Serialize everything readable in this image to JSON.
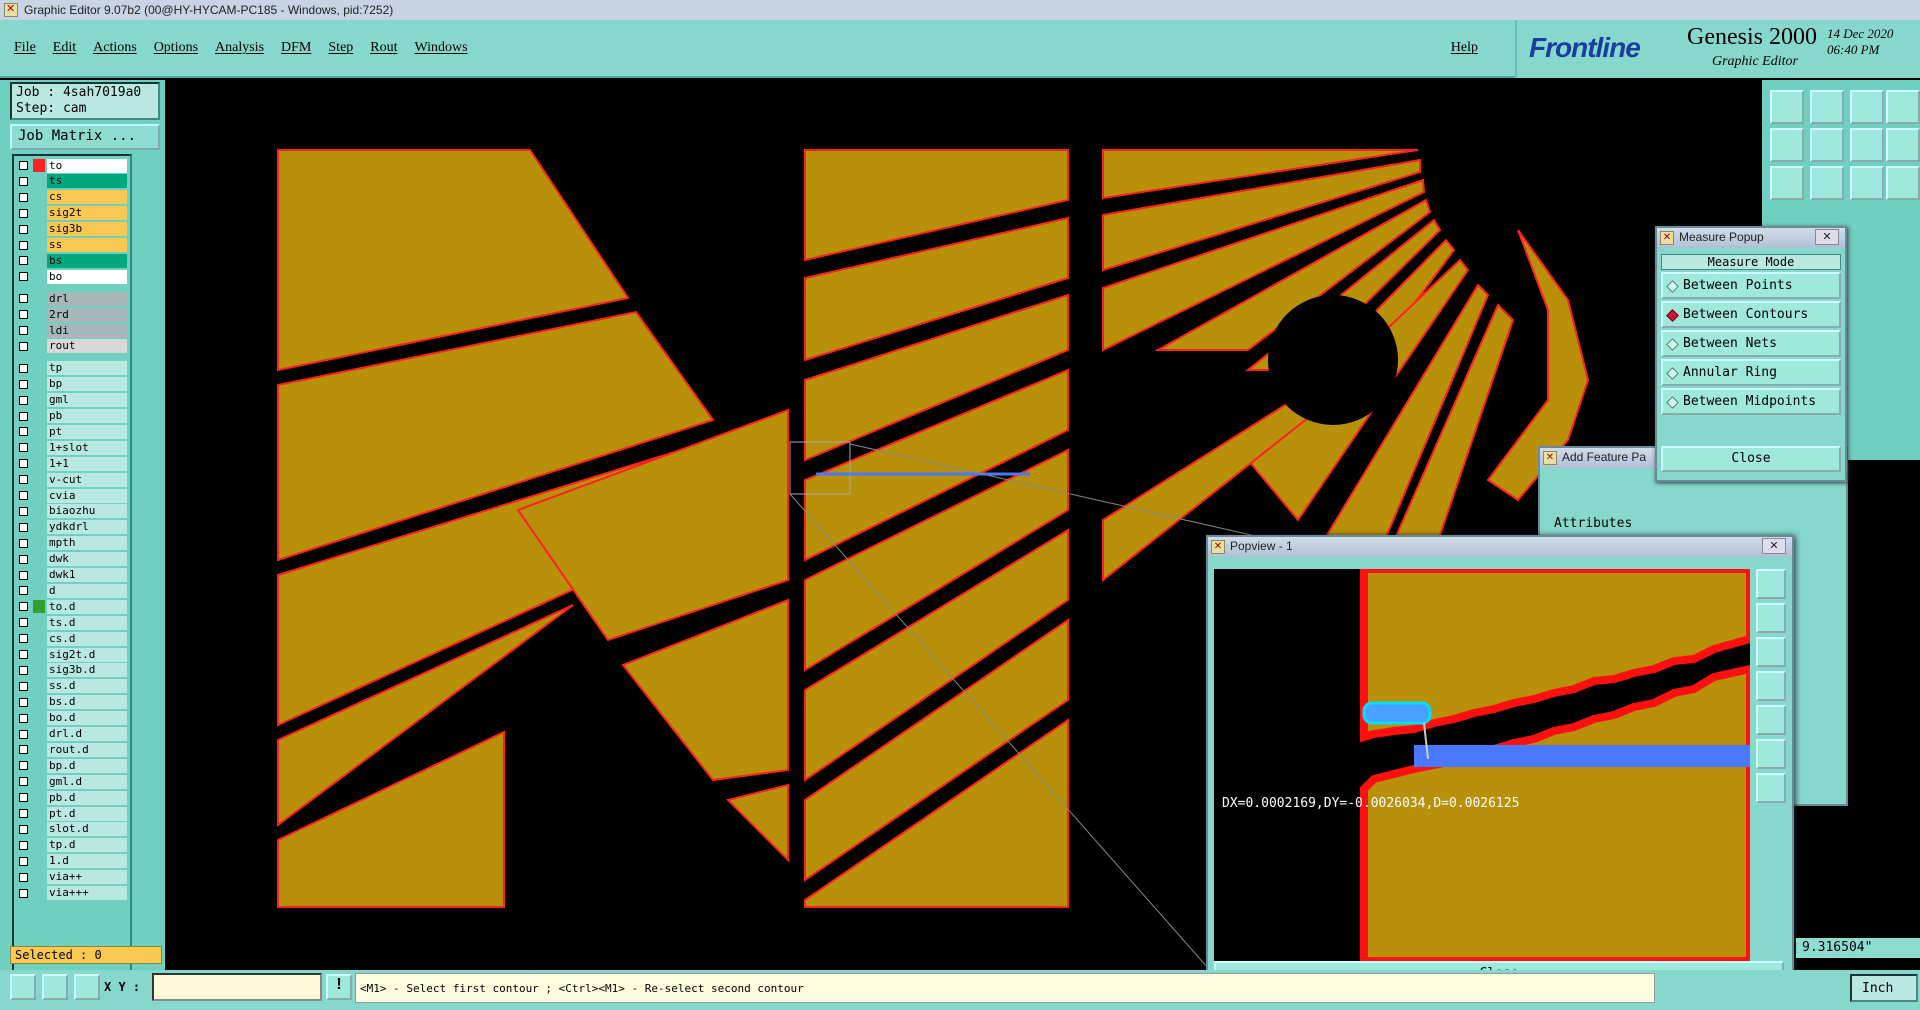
{
  "window": {
    "title": "Graphic Editor 9.07b2 (00@HY-HYCAM-PC185 - Windows, pid:7252)"
  },
  "menu": {
    "items": [
      "File",
      "Edit",
      "Actions",
      "Options",
      "Analysis",
      "DFM",
      "Step",
      "Rout",
      "Windows"
    ],
    "help": "Help"
  },
  "brand": {
    "logo": "Frontline",
    "product": "Genesis 2000",
    "subtitle": "Graphic Editor",
    "date": "14 Dec 2020",
    "time": "06:40 PM"
  },
  "job": {
    "job_line": "Job : 4sah7019a0",
    "step_line": "Step: cam",
    "matrix_button": "Job Matrix ..."
  },
  "layers": [
    {
      "name": "to",
      "color": "#ffffff"
    },
    {
      "name": "ts",
      "color": "#00a880"
    },
    {
      "name": "cs",
      "color": "#f8c850"
    },
    {
      "name": "sig2t",
      "color": "#f8c850"
    },
    {
      "name": "sig3b",
      "color": "#f8c850"
    },
    {
      "name": "ss",
      "color": "#f8c850"
    },
    {
      "name": "bs",
      "color": "#00a880"
    },
    {
      "name": "bo",
      "color": "#ffffff"
    },
    {
      "name": "drl",
      "color": "#a8b8b8"
    },
    {
      "name": "2rd",
      "color": "#a8b8b8"
    },
    {
      "name": "ldi",
      "color": "#a8b8b8"
    },
    {
      "name": "rout",
      "color": "#d8d8d8"
    },
    {
      "name": "tp",
      "color": "#b8e8e0"
    },
    {
      "name": "bp",
      "color": "#b8e8e0"
    },
    {
      "name": "gml",
      "color": "#b8e8e0"
    },
    {
      "name": "pb",
      "color": "#b8e8e0"
    },
    {
      "name": "pt",
      "color": "#b8e8e0"
    },
    {
      "name": "1+slot",
      "color": "#b8e8e0"
    },
    {
      "name": "1+1",
      "color": "#b8e8e0"
    },
    {
      "name": "v-cut",
      "color": "#b8e8e0"
    },
    {
      "name": "cvia",
      "color": "#b8e8e0"
    },
    {
      "name": "biaozhu",
      "color": "#b8e8e0"
    },
    {
      "name": "ydkdrl",
      "color": "#b8e8e0"
    },
    {
      "name": "mpth",
      "color": "#b8e8e0"
    },
    {
      "name": "dwk",
      "color": "#b8e8e0"
    },
    {
      "name": "dwk1",
      "color": "#b8e8e0"
    },
    {
      "name": "d",
      "color": "#b8e8e0"
    },
    {
      "name": "to.d",
      "color": "#b8e8e0"
    },
    {
      "name": "ts.d",
      "color": "#b8e8e0"
    },
    {
      "name": "cs.d",
      "color": "#b8e8e0"
    },
    {
      "name": "sig2t.d",
      "color": "#b8e8e0"
    },
    {
      "name": "sig3b.d",
      "color": "#b8e8e0"
    },
    {
      "name": "ss.d",
      "color": "#b8e8e0"
    },
    {
      "name": "bs.d",
      "color": "#b8e8e0"
    },
    {
      "name": "bo.d",
      "color": "#b8e8e0"
    },
    {
      "name": "drl.d",
      "color": "#b8e8e0"
    },
    {
      "name": "rout.d",
      "color": "#b8e8e0"
    },
    {
      "name": "bp.d",
      "color": "#b8e8e0"
    },
    {
      "name": "gml.d",
      "color": "#b8e8e0"
    },
    {
      "name": "pb.d",
      "color": "#b8e8e0"
    },
    {
      "name": "pt.d",
      "color": "#b8e8e0"
    },
    {
      "name": "slot.d",
      "color": "#b8e8e0"
    },
    {
      "name": "tp.d",
      "color": "#b8e8e0"
    },
    {
      "name": "1.d",
      "color": "#b8e8e0"
    },
    {
      "name": "via++",
      "color": "#b8e8e0"
    },
    {
      "name": "via+++",
      "color": "#b8e8e0"
    }
  ],
  "selected": "Selected : 0",
  "status": {
    "xy_label": "X Y :",
    "xy_value": "",
    "hint": "<M1> - Select first contour ; <Ctrl><M1> - Re-select second contour",
    "unit": "Inch",
    "coord": "9.316504\""
  },
  "measure_popup": {
    "title": "Measure Popup",
    "mode_header": "Measure Mode",
    "modes": [
      "Between Points",
      "Between Contours",
      "Between Nets",
      "Annular Ring",
      "Between Midpoints"
    ],
    "selected_mode": "Between Contours",
    "close": "Close"
  },
  "add_feature": {
    "title": "Add Feature Pa",
    "attributes": "Attributes"
  },
  "popview": {
    "title": "Popview - 1",
    "measure_text": "DX=0.0002169,DY=-0.0026034,D=0.0026125",
    "close": "Close"
  },
  "colors": {
    "copper": "#b8900a",
    "outline": "#ff2020",
    "panel": "#86d8cc",
    "measure_line": "#4a78ff"
  }
}
